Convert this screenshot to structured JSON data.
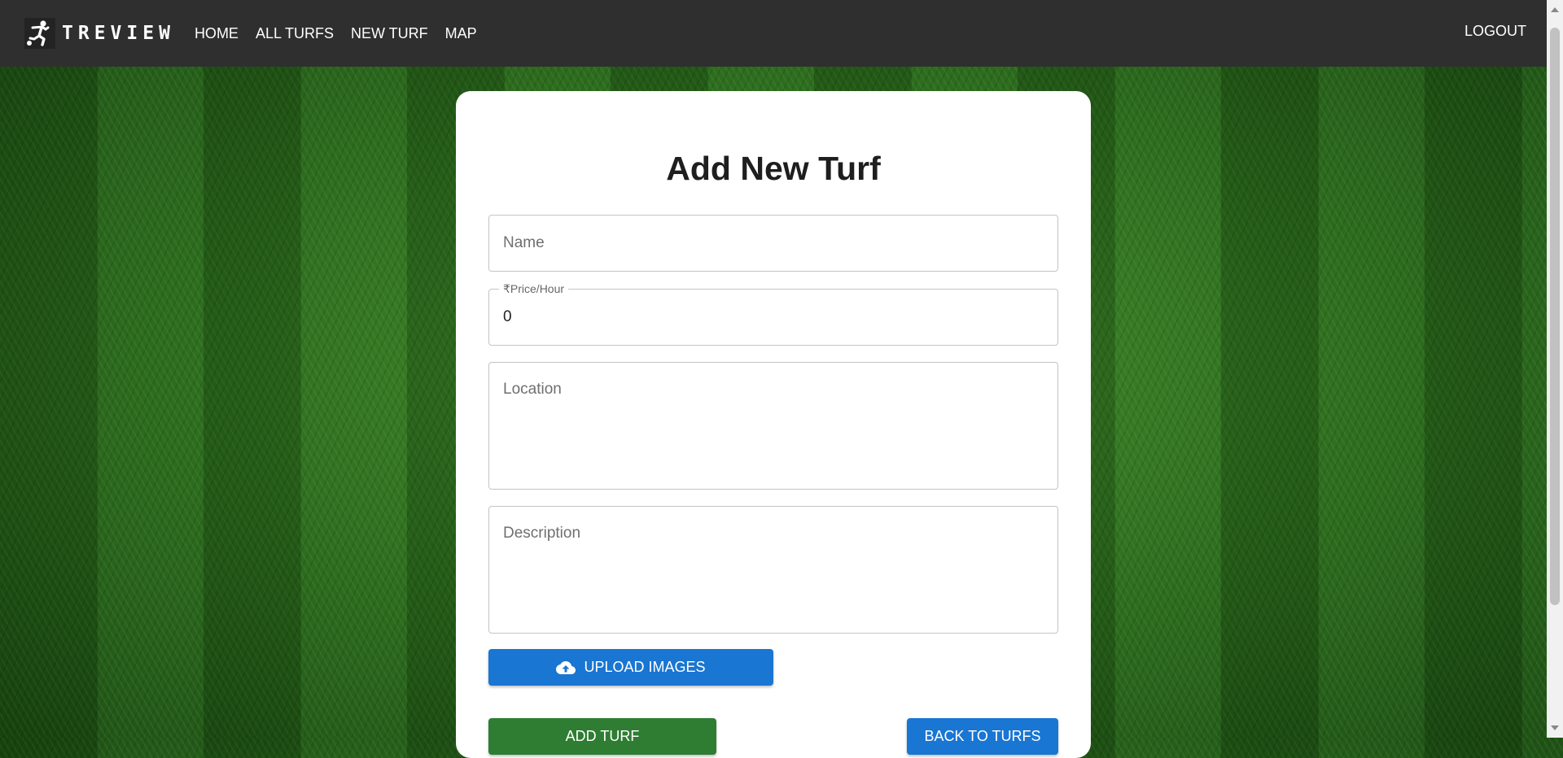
{
  "navbar": {
    "brand": "TREVIEW",
    "links": [
      "HOME",
      "ALL TURFS",
      "NEW TURF",
      "MAP"
    ],
    "logout": "LOGOUT"
  },
  "form": {
    "title": "Add New Turf",
    "name_placeholder": "Name",
    "price_label": "₹Price/Hour",
    "price_value": "0",
    "location_placeholder": "Location",
    "description_placeholder": "Description",
    "upload_label": "UPLOAD IMAGES",
    "add_label": "ADD TURF",
    "back_label": "BACK TO TURFS"
  },
  "colors": {
    "navbar_bg": "#2f2f2f",
    "primary_blue": "#1976d2",
    "success_green": "#2e7d32"
  },
  "icons": {
    "brand": "soccer-player-icon",
    "upload": "cloud-upload-icon"
  }
}
